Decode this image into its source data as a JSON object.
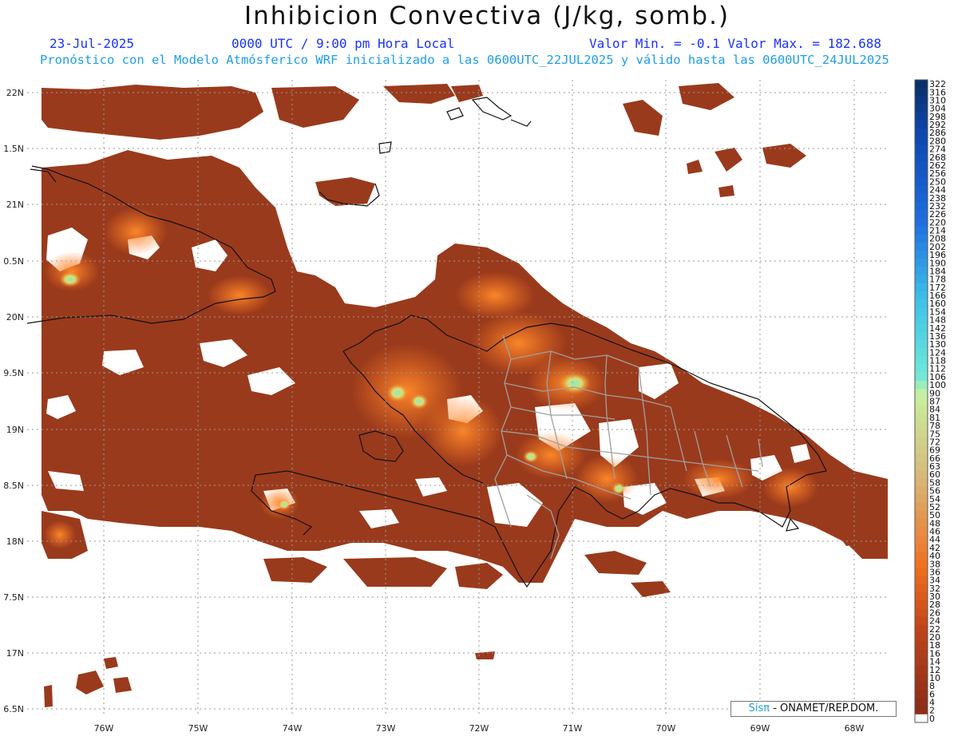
{
  "header": {
    "title": "Inhibicion Convectiva (J/kg, somb.)",
    "date": "23-Jul-2025",
    "time": "0000 UTC / 9:00 pm Hora Local",
    "stats": "Valor Min. = -0.1  Valor Max. = 182.688",
    "model_info": "Pronóstico con el Modelo Atmósferico WRF inicializado a las 0600UTC_22JUL2025 y válido hasta las  0600UTC_24JUL2025"
  },
  "axes": {
    "lon_labels": [
      "76W",
      "75W",
      "74W",
      "73W",
      "72W",
      "71W",
      "70W",
      "69W",
      "68W"
    ],
    "lat_labels": [
      "22N",
      "1.5N",
      "21N",
      "0.5N",
      "20N",
      "9.5N",
      "19N",
      "8.5N",
      "18N",
      "7.5N",
      "17N",
      "6.5N"
    ]
  },
  "colorbar": {
    "labels": [
      "322",
      "316",
      "310",
      "304",
      "298",
      "292",
      "286",
      "280",
      "274",
      "268",
      "262",
      "256",
      "250",
      "244",
      "238",
      "232",
      "226",
      "220",
      "214",
      "208",
      "202",
      "196",
      "190",
      "184",
      "178",
      "172",
      "166",
      "160",
      "154",
      "148",
      "142",
      "136",
      "130",
      "124",
      "118",
      "112",
      "106",
      "100",
      "90",
      "87",
      "84",
      "81",
      "78",
      "75",
      "72",
      "69",
      "66",
      "63",
      "60",
      "58",
      "56",
      "54",
      "52",
      "50",
      "48",
      "46",
      "44",
      "42",
      "40",
      "38",
      "36",
      "34",
      "32",
      "30",
      "28",
      "26",
      "24",
      "22",
      "20",
      "18",
      "16",
      "14",
      "12",
      "10",
      "8",
      "6",
      "4",
      "2",
      "0"
    ],
    "colors": {
      "max": "#08306b",
      "blue": "#1f6fe0",
      "cyan": "#3fc0e8",
      "aqua": "#70e8d8",
      "green": "#c8f0a0",
      "tan": "#d8b878",
      "orange": "#f07020",
      "rust": "#c0441a",
      "brown": "#8e2e18",
      "zero": "#ffffff"
    }
  },
  "map_colors": {
    "field_base": "#9a3a1c",
    "field_warm": "#d85420",
    "field_hot": "#ff7a22",
    "field_peak": "#8fe6c8",
    "coast": "#111111",
    "borders": "#a0a0a0"
  },
  "credit": {
    "brand": "Sisπ",
    "text": " - ONAMET/REP.DOM."
  }
}
